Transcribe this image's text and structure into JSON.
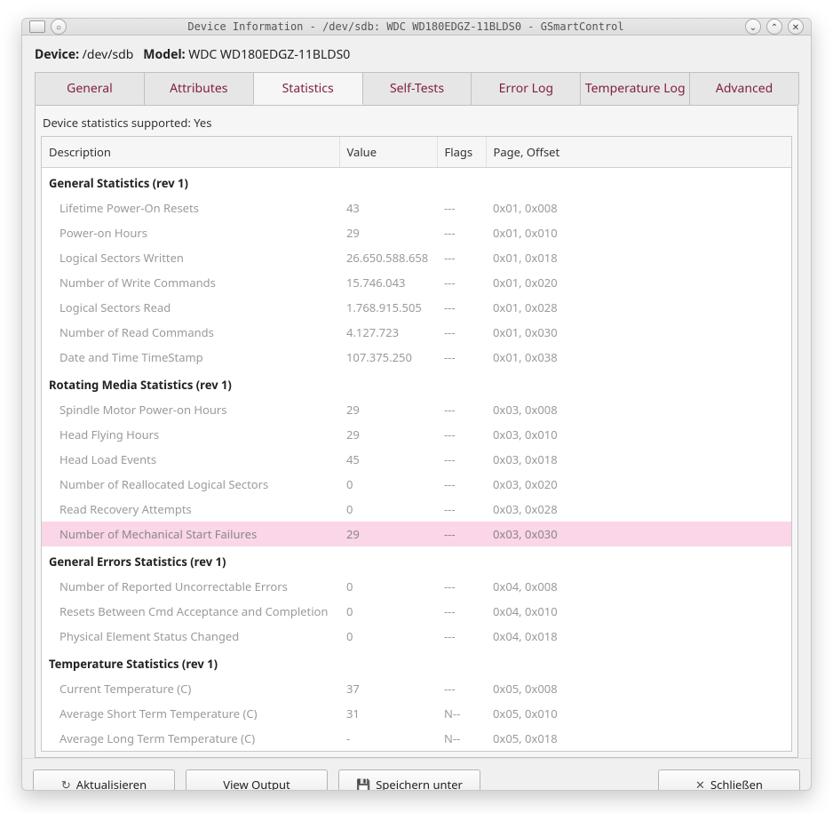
{
  "window": {
    "title": "Device Information - /dev/sdb: WDC WD180EDGZ-11BLDS0 - GSmartControl"
  },
  "header": {
    "device_label": "Device:",
    "device_value": "/dev/sdb",
    "model_label": "Model:",
    "model_value": "WDC WD180EDGZ-11BLDS0"
  },
  "tabs": [
    {
      "label": "General"
    },
    {
      "label": "Attributes"
    },
    {
      "label": "Statistics"
    },
    {
      "label": "Self-Tests"
    },
    {
      "label": "Error Log"
    },
    {
      "label": "Temperature Log"
    },
    {
      "label": "Advanced"
    }
  ],
  "active_tab": 2,
  "support_line": "Device statistics supported: Yes",
  "columns": {
    "description": "Description",
    "value": "Value",
    "flags": "Flags",
    "offset": "Page, Offset"
  },
  "groups": [
    {
      "title": "General Statistics (rev 1)",
      "rows": [
        {
          "desc": "Lifetime Power-On Resets",
          "value": "43",
          "flags": "---",
          "offset": "0x01, 0x008"
        },
        {
          "desc": "Power-on Hours",
          "value": "29",
          "flags": "---",
          "offset": "0x01, 0x010"
        },
        {
          "desc": "Logical Sectors Written",
          "value": "26.650.588.658",
          "flags": "---",
          "offset": "0x01, 0x018"
        },
        {
          "desc": "Number of Write Commands",
          "value": "15.746.043",
          "flags": "---",
          "offset": "0x01, 0x020"
        },
        {
          "desc": "Logical Sectors Read",
          "value": "1.768.915.505",
          "flags": "---",
          "offset": "0x01, 0x028"
        },
        {
          "desc": "Number of Read Commands",
          "value": "4.127.723",
          "flags": "---",
          "offset": "0x01, 0x030"
        },
        {
          "desc": "Date and Time TimeStamp",
          "value": "107.375.250",
          "flags": "---",
          "offset": "0x01, 0x038"
        }
      ]
    },
    {
      "title": "Rotating Media Statistics (rev 1)",
      "rows": [
        {
          "desc": "Spindle Motor Power-on Hours",
          "value": "29",
          "flags": "---",
          "offset": "0x03, 0x008"
        },
        {
          "desc": "Head Flying Hours",
          "value": "29",
          "flags": "---",
          "offset": "0x03, 0x010"
        },
        {
          "desc": "Head Load Events",
          "value": "45",
          "flags": "---",
          "offset": "0x03, 0x018"
        },
        {
          "desc": "Number of Reallocated Logical Sectors",
          "value": "0",
          "flags": "---",
          "offset": "0x03, 0x020"
        },
        {
          "desc": "Read Recovery Attempts",
          "value": "0",
          "flags": "---",
          "offset": "0x03, 0x028"
        },
        {
          "desc": "Number of Mechanical Start Failures",
          "value": "29",
          "flags": "---",
          "offset": "0x03, 0x030",
          "highlight": true
        }
      ]
    },
    {
      "title": "General Errors Statistics (rev 1)",
      "rows": [
        {
          "desc": "Number of Reported Uncorrectable Errors",
          "value": "0",
          "flags": "---",
          "offset": "0x04, 0x008"
        },
        {
          "desc": "Resets Between Cmd Acceptance and Completion",
          "value": "0",
          "flags": "---",
          "offset": "0x04, 0x010"
        },
        {
          "desc": "Physical Element Status Changed",
          "value": "0",
          "flags": "---",
          "offset": "0x04, 0x018"
        }
      ]
    },
    {
      "title": "Temperature Statistics (rev 1)",
      "rows": [
        {
          "desc": "Current Temperature (C)",
          "value": "37",
          "flags": "---",
          "offset": "0x05, 0x008"
        },
        {
          "desc": "Average Short Term Temperature (C)",
          "value": "31",
          "flags": "N--",
          "offset": "0x05, 0x010"
        },
        {
          "desc": "Average Long Term Temperature (C)",
          "value": "-",
          "flags": "N--",
          "offset": "0x05, 0x018"
        }
      ]
    }
  ],
  "buttons": {
    "refresh": "Aktualisieren",
    "view_output": "View Output",
    "save_under": "Speichern unter",
    "close": "Schließen"
  },
  "icons": {
    "refresh": "↻",
    "save": "💾",
    "close": "✕",
    "minimize": "⌄",
    "maximize": "⌃",
    "win_close": "✕",
    "menu": "○"
  }
}
